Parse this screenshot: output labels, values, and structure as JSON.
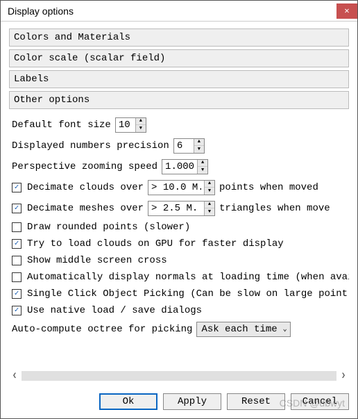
{
  "window": {
    "title": "Display options"
  },
  "sections": {
    "colors": "Colors and Materials",
    "scale": "Color scale (scalar field)",
    "labels": "Labels",
    "other": "Other options"
  },
  "options": {
    "font_size_label": "Default font size",
    "font_size_value": "10",
    "precision_label": "Displayed numbers precision",
    "precision_value": "6",
    "zoom_label": "Perspective zooming speed",
    "zoom_value": "1.000",
    "decimate_clouds_label": "Decimate clouds over",
    "decimate_clouds_value": "> 10.0 M.",
    "decimate_clouds_after": "points when moved",
    "decimate_meshes_label": "Decimate meshes over",
    "decimate_meshes_value": "> 2.5 M.",
    "decimate_meshes_after": "triangles when move",
    "rounded_points": "Draw rounded points (slower)",
    "gpu_load": "Try to load clouds on GPU for faster display",
    "middle_cross": "Show middle screen cross",
    "auto_normals": "Automatically display normals at loading time (when avail",
    "single_click": "Single Click Object Picking (Can be slow on large point c",
    "native_dialogs": "Use native load / save dialogs",
    "octree_label": "Auto-compute octree for picking",
    "octree_value": "Ask each time"
  },
  "buttons": {
    "ok": "Ok",
    "apply": "Apply",
    "reset": "Reset",
    "cancel": "Cancel"
  },
  "watermark": "CSDN @dbwyt"
}
